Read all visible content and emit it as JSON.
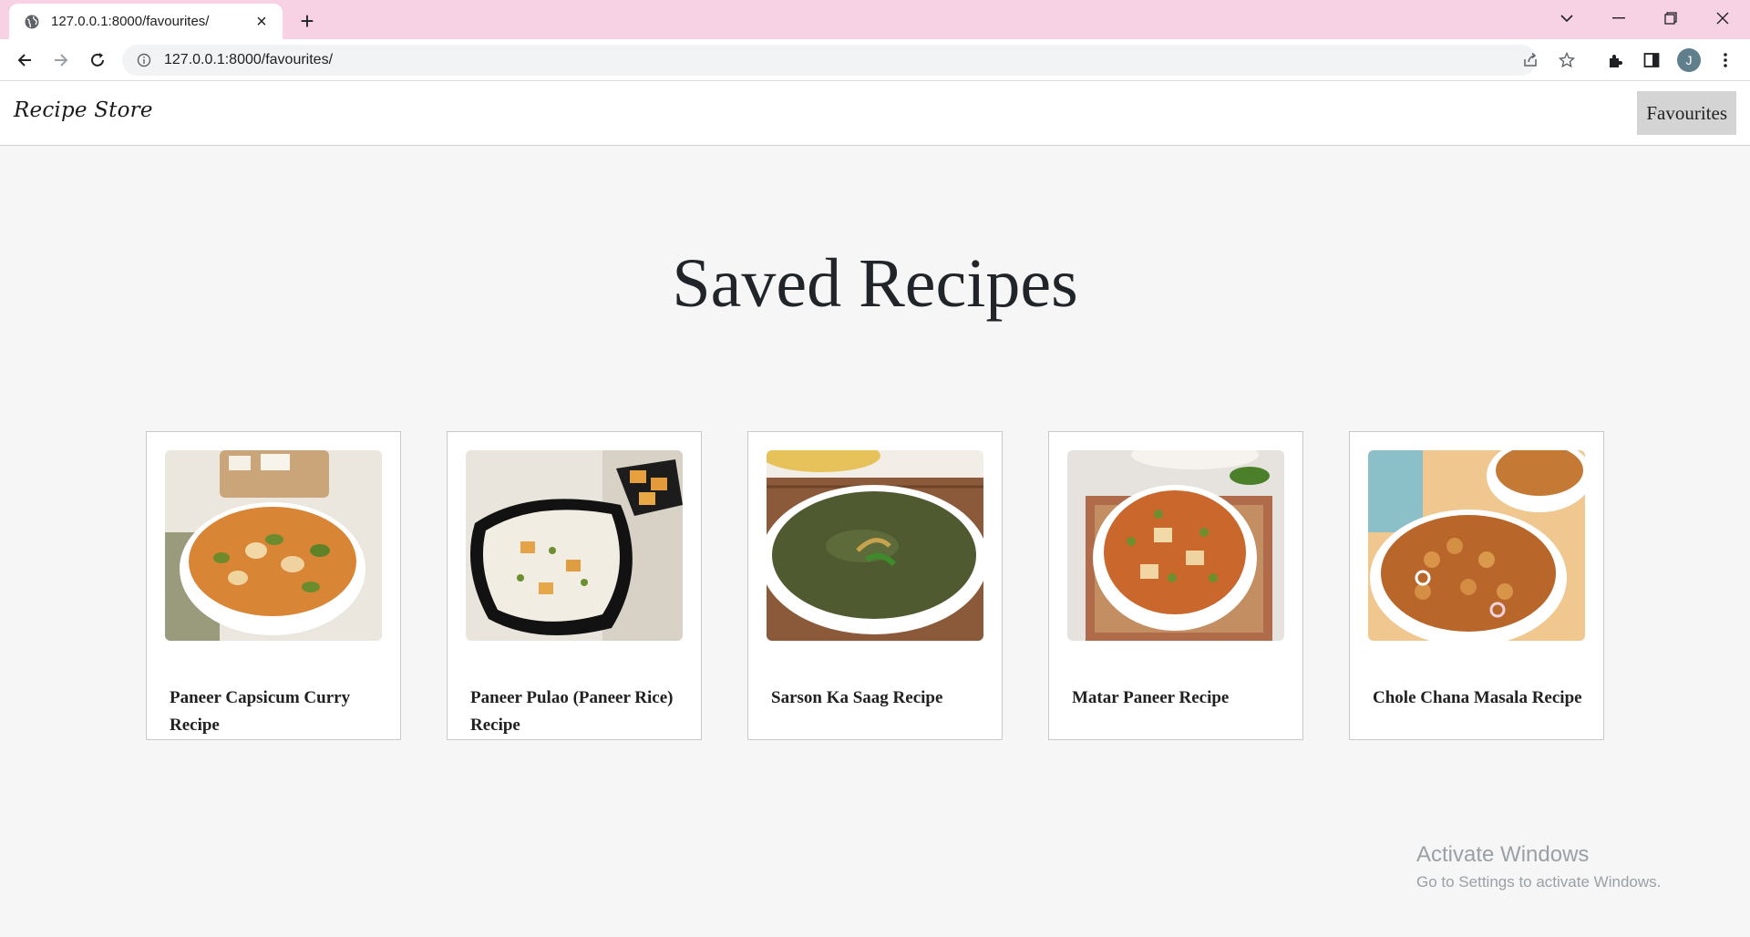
{
  "browser": {
    "tab_title": "127.0.0.1:8000/favourites/",
    "url": "127.0.0.1:8000/favourites/",
    "profile_initial": "J"
  },
  "site": {
    "brand": "Recipe Store",
    "nav_favourites": "Favourites"
  },
  "main": {
    "title": "Saved Recipes",
    "recipes": [
      {
        "title": "Paneer Capsicum Curry Recipe"
      },
      {
        "title": "Paneer Pulao (Paneer Rice) Recipe"
      },
      {
        "title": "Sarson Ka Saag Recipe"
      },
      {
        "title": "Matar Paneer Recipe"
      },
      {
        "title": "Chole Chana Masala Recipe"
      }
    ]
  },
  "os_watermark": {
    "line1": "Activate Windows",
    "line2": "Go to Settings to activate Windows."
  },
  "colors": {
    "tabstrip": "#f6d2e4",
    "page_background": "#f5f6f5",
    "favourites_button": "#d4d4d4"
  }
}
